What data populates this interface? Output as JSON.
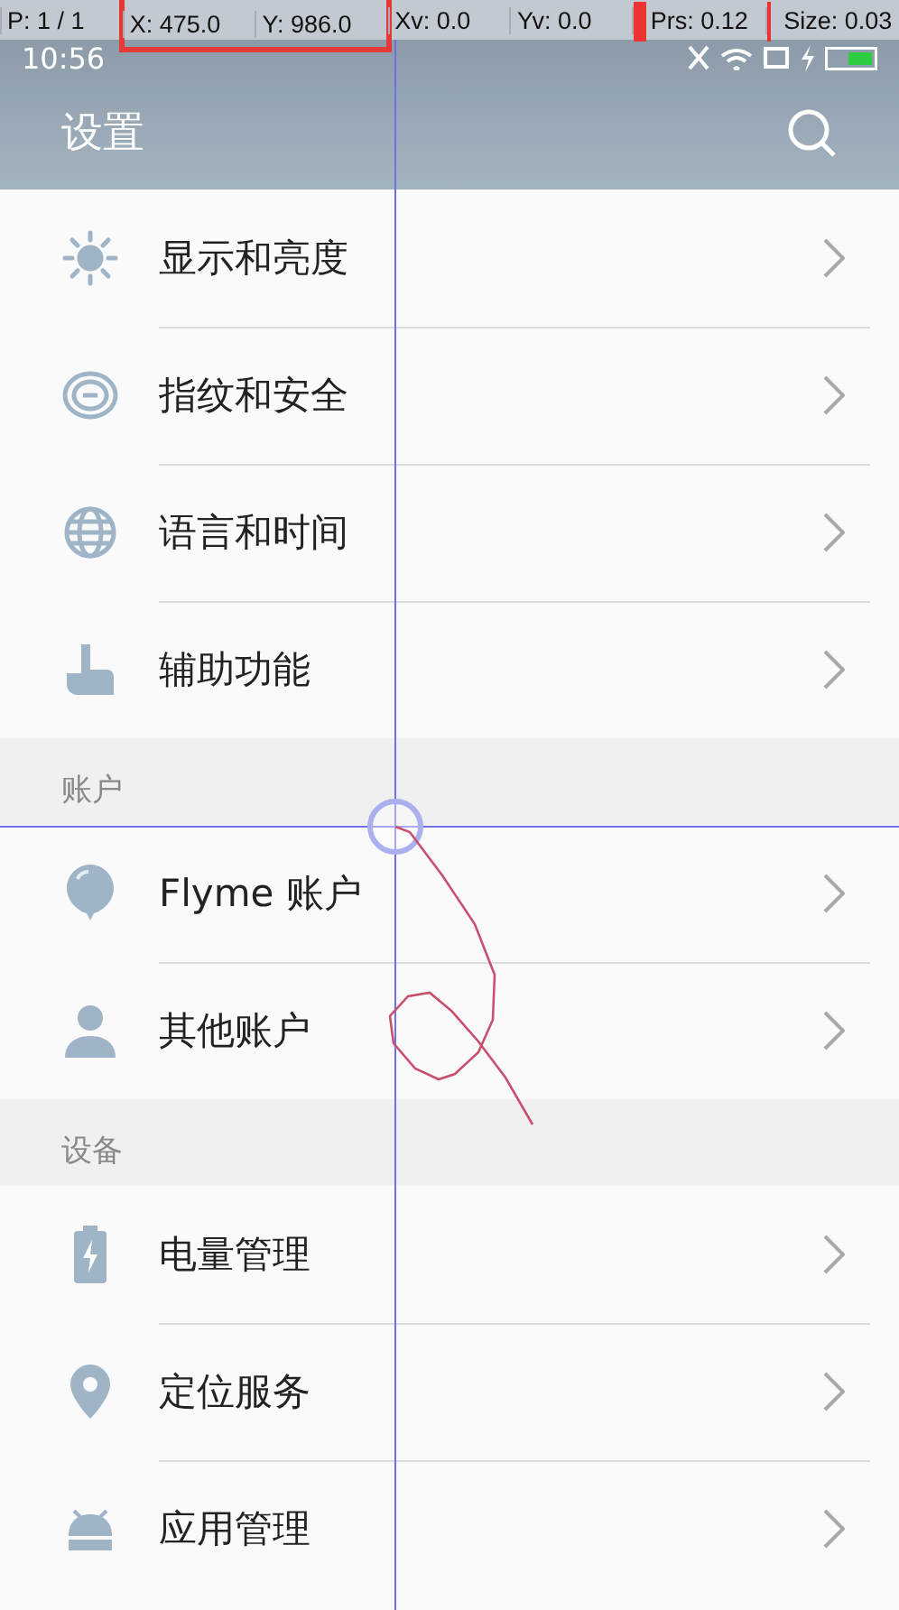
{
  "pointer_info": [
    {
      "label": "P: 1 / 1",
      "highlighted": false
    },
    {
      "label": "X: 475.0",
      "highlighted": true
    },
    {
      "label": "Y: 986.0",
      "highlighted": true
    },
    {
      "label": "Xv: 0.0",
      "highlighted": false
    },
    {
      "label": "Yv: 0.0",
      "highlighted": false
    },
    {
      "label": "Prs: 0.12",
      "highlighted": false,
      "level": 0.12
    },
    {
      "label": "Size: 0.03",
      "highlighted": false,
      "level": 0.03
    }
  ],
  "status_bar": {
    "time": "10:56"
  },
  "app_bar": {
    "title": "设置"
  },
  "sections": [
    {
      "items": [
        {
          "label": "显示和亮度"
        },
        {
          "label": "指纹和安全"
        },
        {
          "label": "语言和时间"
        },
        {
          "label": "辅助功能"
        }
      ]
    },
    {
      "header": "账户",
      "items": [
        {
          "label": "Flyme 账户"
        },
        {
          "label": "其他账户"
        }
      ]
    },
    {
      "header": "设备",
      "items": [
        {
          "label": "电量管理"
        },
        {
          "label": "定位服务"
        },
        {
          "label": "应用管理"
        }
      ]
    }
  ]
}
